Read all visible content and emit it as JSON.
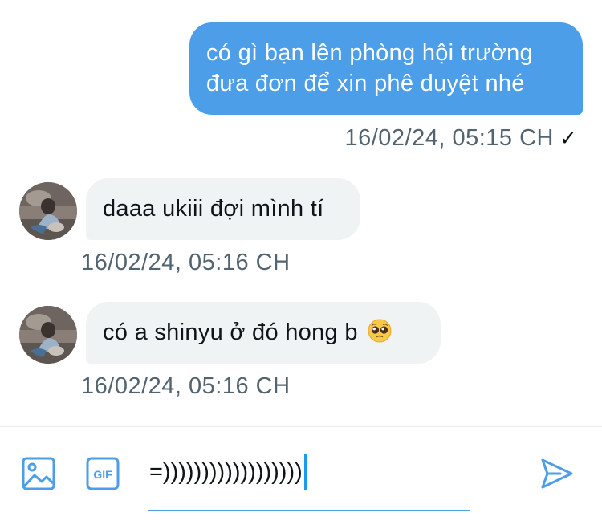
{
  "conversation": {
    "messages": [
      {
        "direction": "outgoing",
        "lines": [
          "có gì bạn lên phòng hội trường",
          "đưa đơn để xin phê duyệt nhé"
        ],
        "timestamp": "16/02/24, 05:15 CH",
        "status_icon": "checkmark-icon",
        "status_glyph": "✓"
      },
      {
        "direction": "incoming",
        "text": "daaa ukiii đợi mình tí",
        "timestamp": "16/02/24, 05:16 CH"
      },
      {
        "direction": "incoming",
        "text": "có a shinyu ở đó hong b",
        "emoji": "pleading-face-emoji",
        "timestamp": "16/02/24, 05:16 CH"
      }
    ]
  },
  "composer": {
    "input_value": "=))))))))))))))))))",
    "media_icon": "image-icon",
    "gif_icon": "gif-icon",
    "gif_label": "GIF",
    "send_icon": "send-icon"
  },
  "colors": {
    "accent": "#4c9ee8",
    "incoming_bubble": "#eff3f4",
    "timestamp_text": "#536471",
    "divider": "#e6ecf0"
  }
}
